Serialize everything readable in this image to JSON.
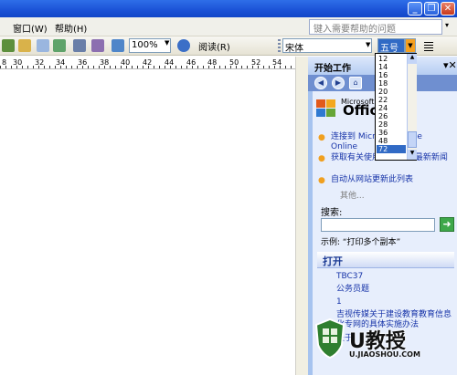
{
  "menubar": {
    "items": [
      {
        "label": "窗口(W)"
      },
      {
        "label": "帮助(H)"
      }
    ],
    "help_placeholder": "键入需要帮助的问题"
  },
  "toolbar": {
    "zoom": "100%",
    "reading_label": "阅读(R)",
    "font_name": "宋体",
    "font_size": "五号"
  },
  "ruler": {
    "numbers": [
      "8",
      "30",
      "32",
      "34",
      "36",
      "38",
      "40",
      "42",
      "44",
      "46",
      "48",
      "50",
      "52",
      "54"
    ]
  },
  "font_size_list": {
    "options": [
      "12",
      "14",
      "16",
      "18",
      "20",
      "22",
      "24",
      "26",
      "28",
      "36",
      "48",
      "72"
    ],
    "selected": "72"
  },
  "task_pane": {
    "title": "开始工作",
    "office_brand": "Microsoft",
    "office_name": "Office",
    "links": [
      "连接到 Microsoft Office Online",
      "获取有关使用 Word 的最新新闻",
      "自动从网站更新此列表"
    ],
    "other": "其他...",
    "search_label": "搜索:",
    "example": "示例:  “打印多个副本”",
    "open_title": "打开",
    "files": [
      "TBC37",
      "公务员题",
      "1",
      "吉视传媒关于建设教育教育信息化专网的具体实施办法",
      "关于"
    ]
  },
  "watermark": {
    "brand": "U教授",
    "url": "U.JIAOSHOU.COM"
  },
  "colors": {
    "title_bar": "#1b52d6",
    "task_pane": "#a6c3ef",
    "selection": "#316ac5"
  }
}
